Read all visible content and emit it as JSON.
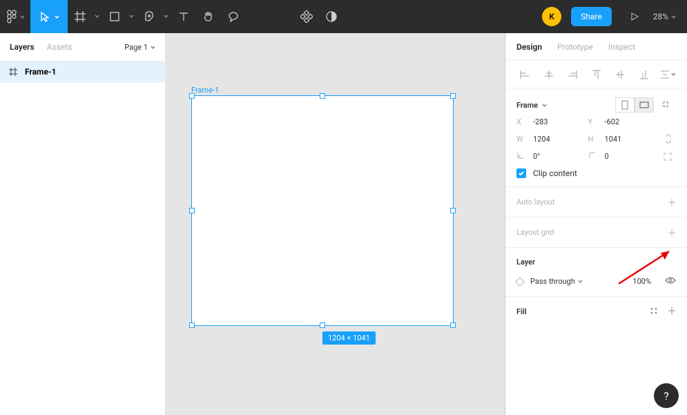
{
  "topbar": {
    "avatar_letter": "K",
    "share_label": "Share",
    "zoom_label": "28%"
  },
  "left": {
    "tabs": {
      "layers": "Layers",
      "assets": "Assets"
    },
    "page_selector": "Page 1",
    "layers": [
      {
        "name": "Frame-1"
      }
    ]
  },
  "canvas": {
    "frame_label": "Frame-1",
    "dimensions_badge": "1204 × 1041"
  },
  "right": {
    "tabs": {
      "design": "Design",
      "prototype": "Prototype",
      "inspect": "Inspect"
    },
    "frame_section": {
      "title": "Frame",
      "x_label": "X",
      "x_value": "-283",
      "y_label": "Y",
      "y_value": "-602",
      "w_label": "W",
      "w_value": "1204",
      "h_label": "H",
      "h_value": "1041",
      "rot_value": "0°",
      "radius_value": "0",
      "clip_label": "Clip content"
    },
    "auto_layout_label": "Auto layout",
    "layout_grid_label": "Layout grid",
    "layer_section": {
      "title": "Layer",
      "blend": "Pass through",
      "opacity": "100%"
    },
    "fill_section": {
      "title": "Fill"
    }
  },
  "help_label": "?"
}
